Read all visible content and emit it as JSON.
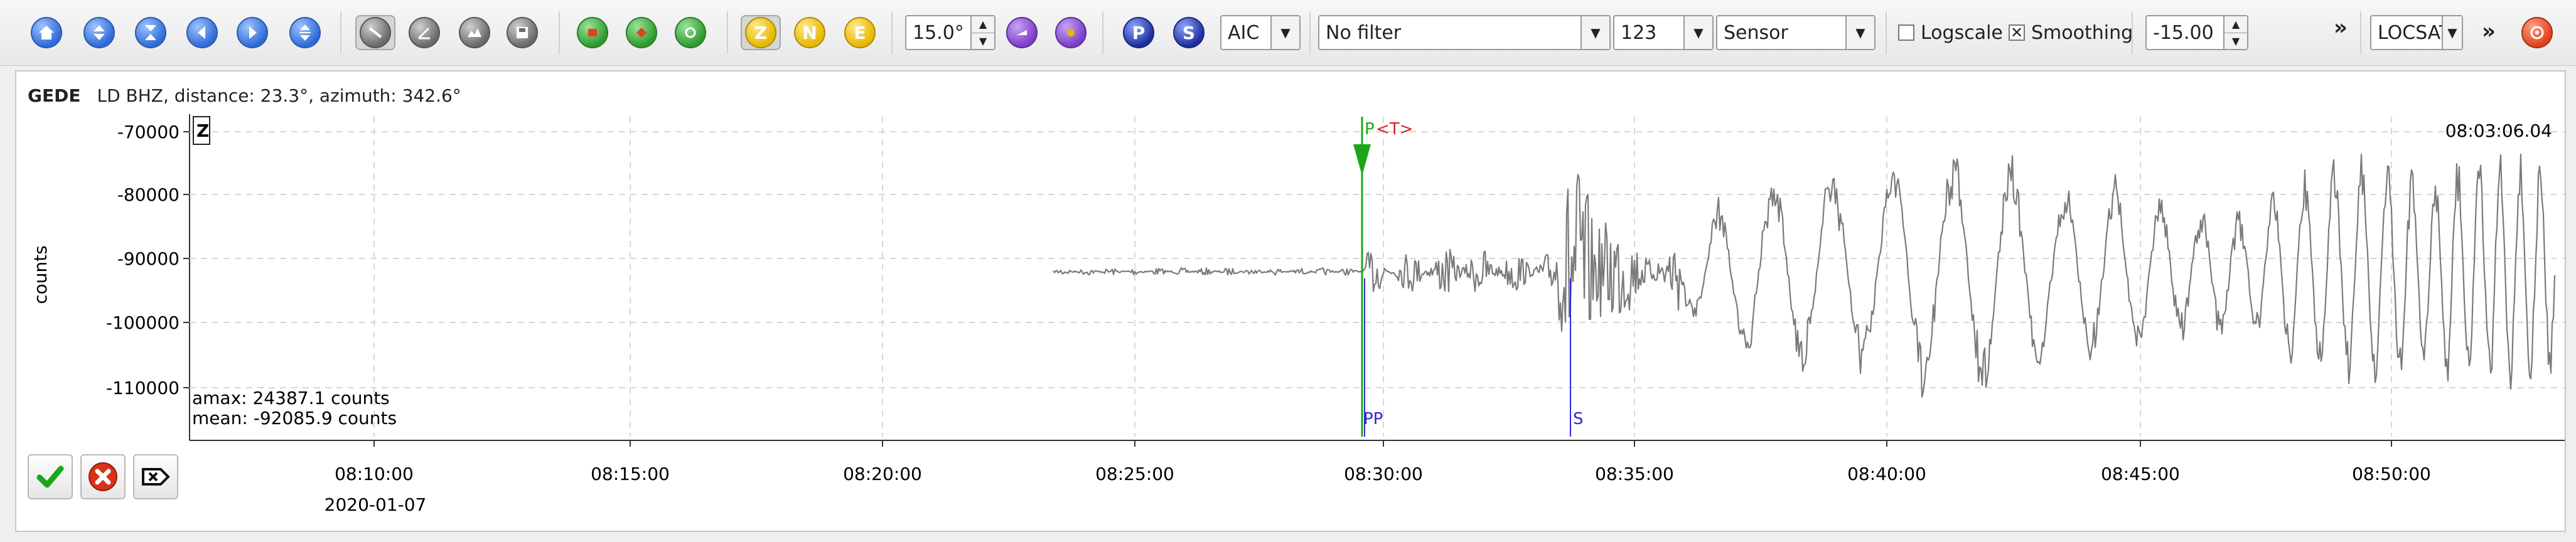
{
  "toolbar": {
    "nav_icons": [
      "home-icon",
      "zoom-in-icon",
      "zoom-out-icon",
      "previous-icon",
      "next-icon",
      "expand-vertical-icon"
    ],
    "tool_icons": [
      "measure-icon",
      "angle-icon",
      "spectrogram-icon",
      "save-trace-icon"
    ],
    "pick_icons": [
      "pick-p-icon",
      "pick-s-icon",
      "auto-pick-icon"
    ],
    "components": [
      "Z",
      "N",
      "E"
    ],
    "active_component": "Z",
    "angle_value": "15.0°",
    "picker_labels": [
      "P",
      "S"
    ],
    "method_value": "AIC",
    "filter_value": "No filter",
    "channel_value": "123",
    "unit_value": "Sensor",
    "logscale_label": "Logscale",
    "logscale_checked": false,
    "smoothing_label": "Smoothing",
    "smoothing_checked": true,
    "offset_value": "-15.00",
    "overflow_marker": "»",
    "locator_value": "LOCSAT"
  },
  "trace": {
    "station": "GEDE",
    "info": "LD  BHZ, distance: 23.3°, azimuth: 342.6°",
    "component_box": "Z",
    "end_time": "08:03:06.04",
    "ylabel": "counts",
    "amax": "amax: 24387.1 counts",
    "mean": "mean: -92085.9 counts",
    "date": "2020-01-07",
    "y_ticks": [
      "-70000",
      "-80000",
      "-90000",
      "-100000",
      "-110000"
    ],
    "x_ticks": [
      "08:10:00",
      "08:15:00",
      "08:20:00",
      "08:25:00",
      "08:30:00",
      "08:35:00",
      "08:40:00",
      "08:45:00",
      "08:50:00"
    ],
    "picks": [
      {
        "label": "P",
        "color": "#1aa81a"
      },
      {
        "label": "<T>",
        "color": "#e02020"
      },
      {
        "label": "PP",
        "color": "#2a2ad0"
      },
      {
        "label": "S",
        "color": "#2a2ad0"
      }
    ],
    "colors": {
      "trace": "#7a7a7a",
      "grid": "#d8d8d8",
      "pick_green": "#1aa81a",
      "pick_blue": "#2a2ad0"
    }
  },
  "actions": [
    "accept-icon",
    "reject-icon",
    "clear-icon"
  ]
}
